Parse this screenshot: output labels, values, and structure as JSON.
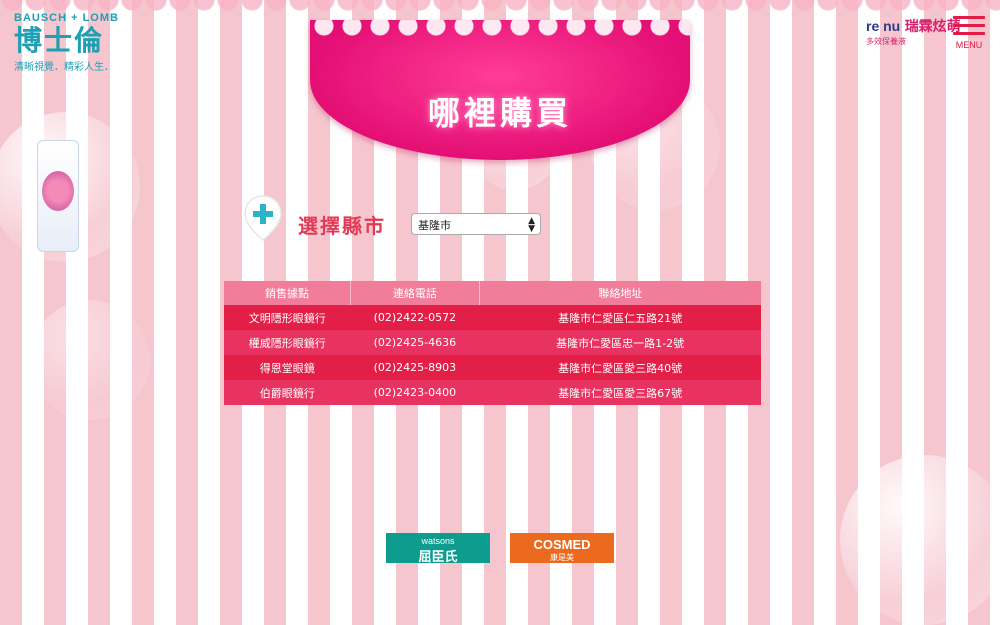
{
  "brand": {
    "en": "BAUSCH + LOMB",
    "cn": "博士倫",
    "slogan": "清晰視覺．精彩人生．"
  },
  "renu": {
    "logo": "re nu",
    "cn": "瑞霖炫萌",
    "sub": "多效保養液"
  },
  "menu": {
    "label": "MENU"
  },
  "banner": {
    "title": "哪裡購買"
  },
  "selector": {
    "label": "選擇縣市",
    "selected": "基隆市"
  },
  "table": {
    "headers": [
      "銷售據點",
      "連絡電話",
      "聯絡地址"
    ],
    "rows": [
      [
        "文明隱形眼鏡行",
        "(02)2422-0572",
        "基隆市仁愛區仁五路21號"
      ],
      [
        "權威隱形眼鏡行",
        "(02)2425-4636",
        "基隆市仁愛區忠一路1-2號"
      ],
      [
        "得恩堂眼鏡",
        "(02)2425-8903",
        "基隆市仁愛區愛三路40號"
      ],
      [
        "伯爵眼鏡行",
        "(02)2423-0400",
        "基隆市仁愛區愛三路67號"
      ]
    ]
  },
  "partners": {
    "watsons": {
      "en": "watsons",
      "cn": "屈臣氏"
    },
    "cosmed": {
      "en": "COSMED",
      "cn": "康是美"
    }
  },
  "colors": {
    "accent": "#e31f47",
    "banner": "#e40f74",
    "teal": "#1f9fb3"
  }
}
